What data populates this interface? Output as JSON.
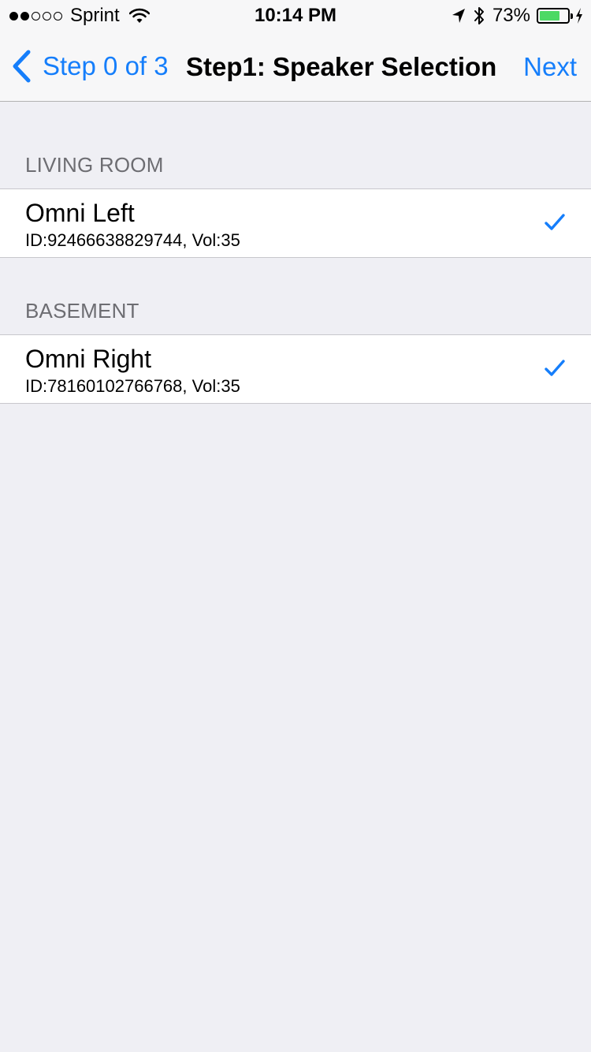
{
  "status_bar": {
    "signal_filled": 2,
    "signal_total": 5,
    "carrier": "Sprint",
    "time": "10:14 PM",
    "battery_percent": "73%",
    "battery_level": 0.73,
    "battery_color": "#4cd964",
    "icons": [
      "wifi-icon",
      "location-arrow-icon",
      "bluetooth-icon",
      "battery-icon",
      "charging-bolt-icon"
    ]
  },
  "nav": {
    "back_label": "Step 0 of 3",
    "title": "Step1: Speaker Selection",
    "next_label": "Next",
    "accent_color": "#157efb"
  },
  "sections": [
    {
      "header": "LIVING ROOM",
      "rows": [
        {
          "title": "Omni Left",
          "subtitle": "ID:92466638829744, Vol:35",
          "checked": true
        }
      ]
    },
    {
      "header": "BASEMENT",
      "rows": [
        {
          "title": "Omni Right",
          "subtitle": "ID:78160102766768, Vol:35",
          "checked": true
        }
      ]
    }
  ]
}
